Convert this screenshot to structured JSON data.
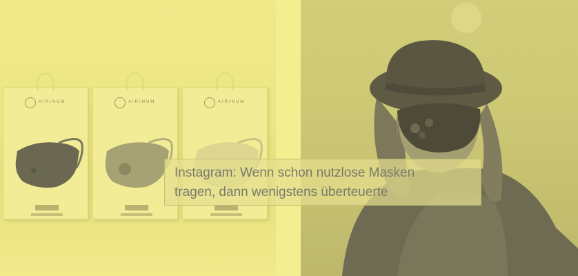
{
  "caption": {
    "line1": "Instagram: Wenn schon nutzlose Masken",
    "line2": "tragen, dann wenigstens überteuerte"
  },
  "products": [
    {
      "brand_mark": "AIRINUM"
    },
    {
      "brand_mark": "AIRINUM"
    },
    {
      "brand_mark": "AIRINUM"
    }
  ],
  "colors": {
    "tint": "#f1ec8e",
    "caption_text": "#7a7a6c",
    "mask_dark": "#5a5846",
    "portrait_shadow": "#6b6750"
  }
}
